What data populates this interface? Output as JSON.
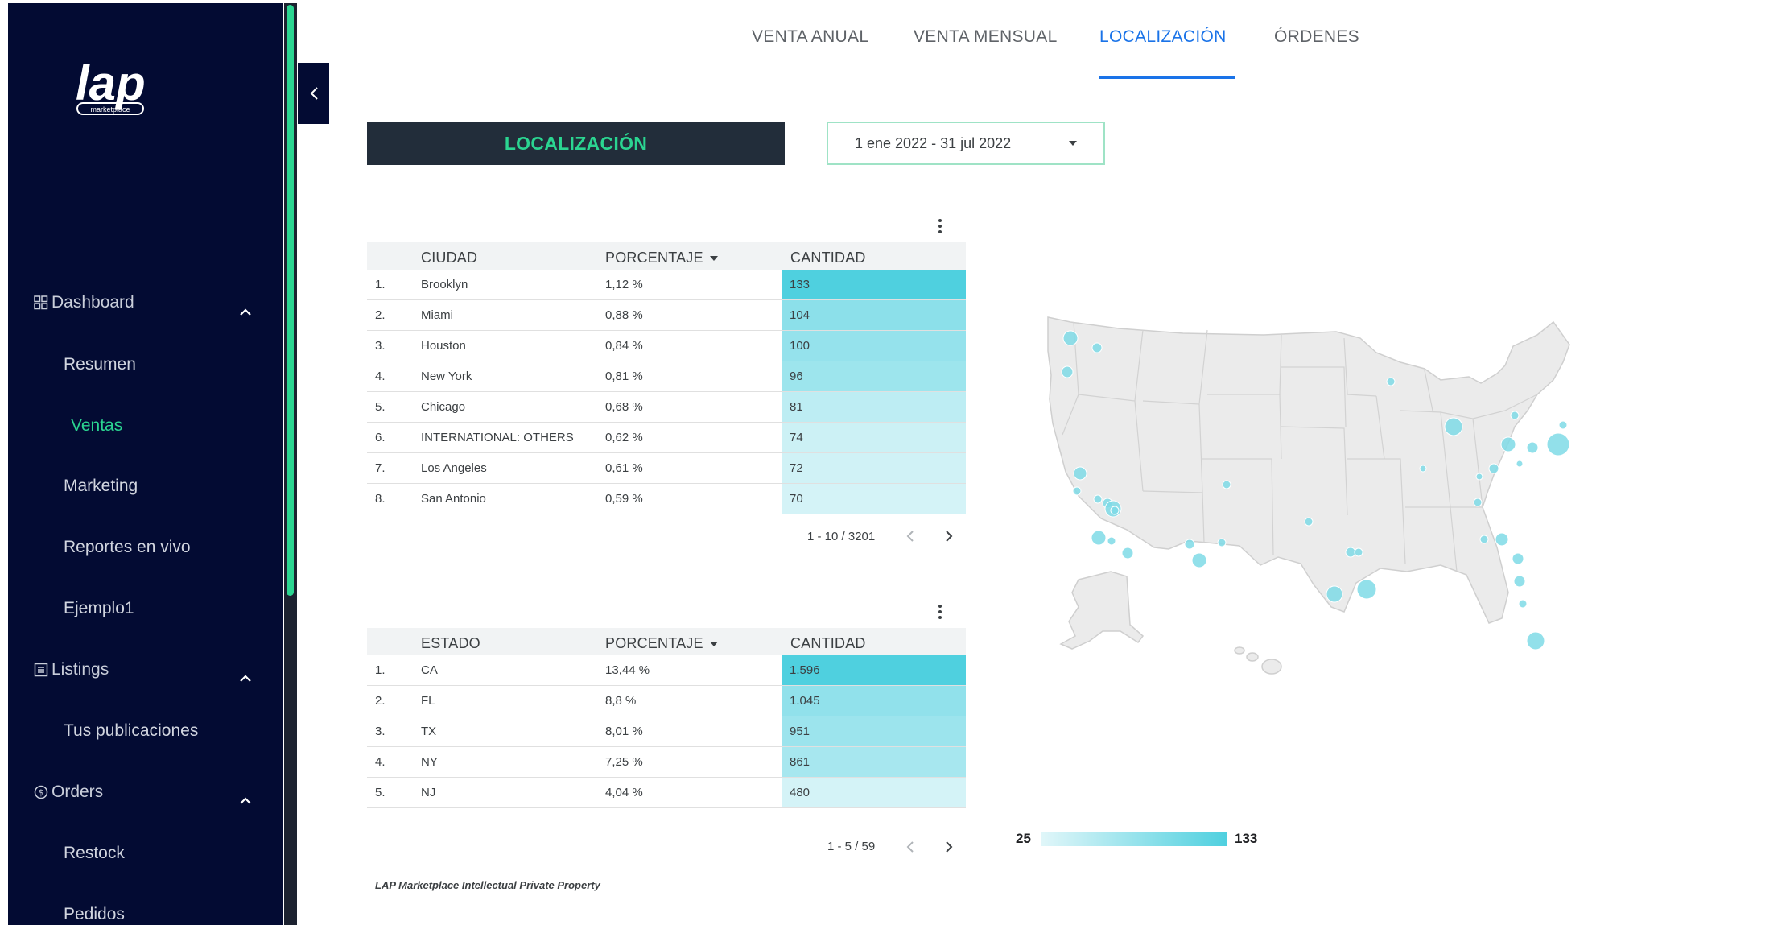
{
  "sidebar": {
    "logo_text": "lap",
    "logo_sub": "marketplace",
    "sections": [
      {
        "label": "Dashboard",
        "icon": "grid-icon"
      },
      {
        "label": "Listings",
        "icon": "list-icon"
      },
      {
        "label": "Orders",
        "icon": "dollar-icon"
      }
    ],
    "items": {
      "resumen": "Resumen",
      "ventas": "Ventas",
      "marketing": "Marketing",
      "reportes": "Reportes en vivo",
      "ejemplo": "Ejemplo1",
      "publicaciones": "Tus publicaciones",
      "restock": "Restock",
      "pedidos": "Pedidos"
    },
    "active_item": "Ventas"
  },
  "tabs": [
    {
      "label": "VENTA ANUAL"
    },
    {
      "label": "VENTA MENSUAL"
    },
    {
      "label": "LOCALIZACIÓN"
    },
    {
      "label": "ÓRDENES"
    }
  ],
  "active_tab": "LOCALIZACIÓN",
  "page_title": "LOCALIZACIÓN",
  "date_range": "1 ene 2022 - 31 jul 2022",
  "city_table": {
    "headers": {
      "city": "CIUDAD",
      "pct": "PORCENTAJE",
      "qty": "CANTIDAD"
    },
    "rows": [
      {
        "n": "1.",
        "name": "Brooklyn",
        "pct": "1,12 %",
        "qty": "133",
        "value": 133
      },
      {
        "n": "2.",
        "name": "Miami",
        "pct": "0,88 %",
        "qty": "104",
        "value": 104
      },
      {
        "n": "3.",
        "name": "Houston",
        "pct": "0,84 %",
        "qty": "100",
        "value": 100
      },
      {
        "n": "4.",
        "name": "New York",
        "pct": "0,81 %",
        "qty": "96",
        "value": 96
      },
      {
        "n": "5.",
        "name": "Chicago",
        "pct": "0,68 %",
        "qty": "81",
        "value": 81
      },
      {
        "n": "6.",
        "name": "INTERNATIONAL: OTHERS",
        "pct": "0,62 %",
        "qty": "74",
        "value": 74
      },
      {
        "n": "7.",
        "name": "Los Angeles",
        "pct": "0,61 %",
        "qty": "72",
        "value": 72
      },
      {
        "n": "8.",
        "name": "San Antonio",
        "pct": "0,59 %",
        "qty": "70",
        "value": 70
      }
    ],
    "pager": "1 - 10 / 3201"
  },
  "state_table": {
    "headers": {
      "state": "ESTADO",
      "pct": "PORCENTAJE",
      "qty": "CANTIDAD"
    },
    "rows": [
      {
        "n": "1.",
        "name": "CA",
        "pct": "13,44 %",
        "qty": "1.596",
        "value": 1596
      },
      {
        "n": "2.",
        "name": "FL",
        "pct": "8,8 %",
        "qty": "1.045",
        "value": 1045
      },
      {
        "n": "3.",
        "name": "TX",
        "pct": "8,01 %",
        "qty": "951",
        "value": 951
      },
      {
        "n": "4.",
        "name": "NY",
        "pct": "7,25 %",
        "qty": "861",
        "value": 861
      },
      {
        "n": "5.",
        "name": "NJ",
        "pct": "4,04 %",
        "qty": "480",
        "value": 480
      }
    ],
    "pager": "1 - 5 / 59"
  },
  "map_legend": {
    "min": "25",
    "max": "133"
  },
  "colors": {
    "accent": "#2bd591",
    "tab_active": "#1a73e8",
    "heat_high": "#4fd0df",
    "heat_low": "#e0f6f9",
    "sidebar": "#030b33"
  },
  "footer": "LAP Marketplace Intellectual Private Property"
}
